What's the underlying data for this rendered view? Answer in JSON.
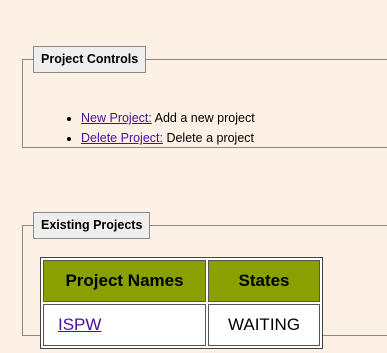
{
  "project_controls": {
    "legend": "Project Controls",
    "items": [
      {
        "link": "New Project:",
        "description": " Add a new project"
      },
      {
        "link": "Delete Project:",
        "description": " Delete a project"
      }
    ]
  },
  "existing_projects": {
    "legend": "Existing Projects",
    "columns": [
      "Project Names",
      "States"
    ],
    "rows": [
      {
        "name": "ISPW",
        "state": "WAITING"
      }
    ]
  },
  "colors": {
    "page_background": "#fcf1e4",
    "header_fill": "#8a9f00",
    "link": "#4a0f9c",
    "legend_background": "#eeeeee"
  }
}
